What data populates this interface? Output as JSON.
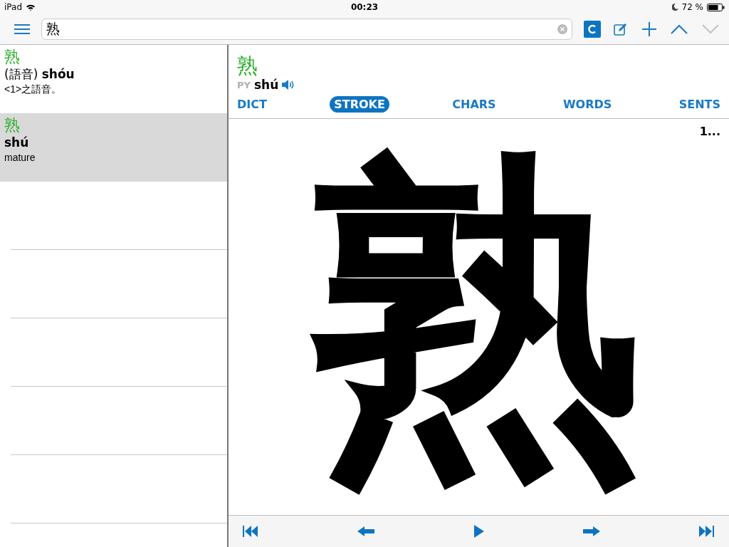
{
  "status_bar": {
    "device": "iPad",
    "time": "00:23",
    "battery": "72 %"
  },
  "search": {
    "value": "熟"
  },
  "results": [
    {
      "headword": "熟",
      "reading": "(語音) **shóu**",
      "gloss": "<1>之語音。",
      "selected": false
    },
    {
      "headword": "熟",
      "reading": "**shú**",
      "gloss": "mature",
      "selected": true
    }
  ],
  "entry": {
    "headword": "熟",
    "py_label": "PY",
    "pinyin": "shú"
  },
  "tabs": [
    {
      "label": "DICT",
      "selected": false
    },
    {
      "label": "STROKE",
      "selected": true
    },
    {
      "label": "CHARS",
      "selected": false
    },
    {
      "label": "WORDS",
      "selected": false
    },
    {
      "label": "SENTS",
      "selected": false
    }
  ],
  "stroke": {
    "character": "熟",
    "count": "1..."
  }
}
